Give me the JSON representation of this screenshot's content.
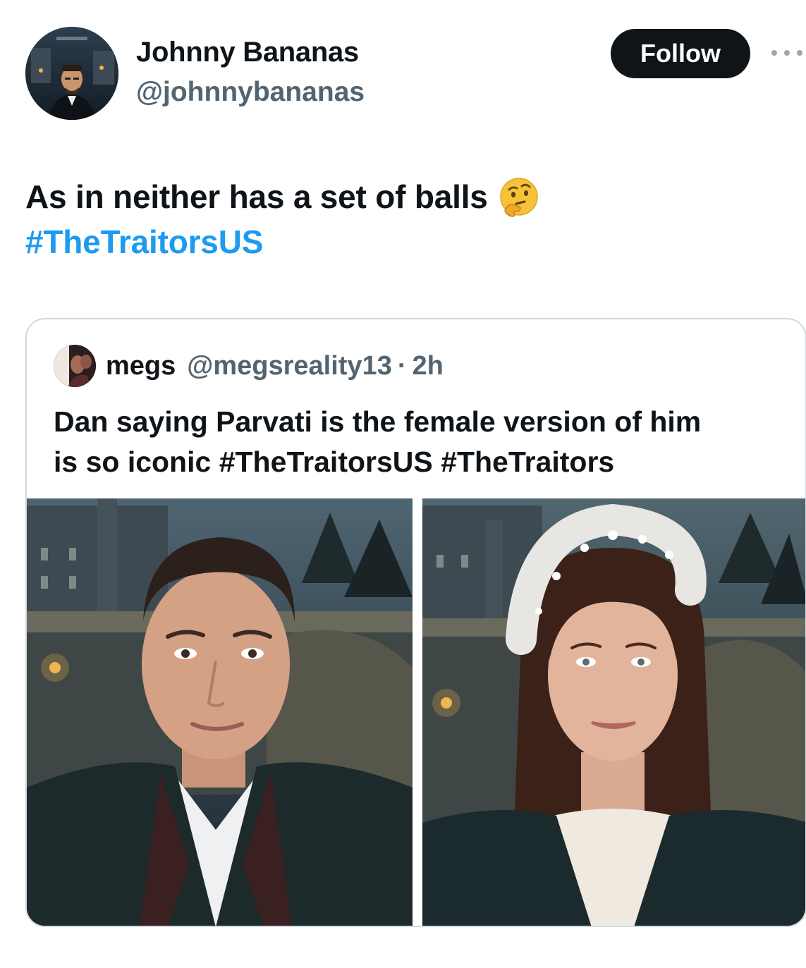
{
  "author": {
    "name": "Johnny Bananas",
    "handle": "@johnnybananas",
    "avatar_icon": "profile-photo"
  },
  "actions": {
    "follow_label": "Follow",
    "more_icon": "ellipsis-icon"
  },
  "tweet": {
    "text": "As in neither has a set of balls",
    "emoji": "thinking-face",
    "hashtag": "#TheTraitorsUS"
  },
  "quote": {
    "name": "megs",
    "handle": "@megsreality13",
    "separator": "·",
    "time": "2h",
    "line1": "Dan saying Parvati is the female version of him",
    "line2_text": "is so iconic ",
    "line2_hashtag1": "#TheTraitorsUS",
    "line2_hashtag2": "#TheTraitors",
    "media": [
      {
        "name": "media-photo-man"
      },
      {
        "name": "media-photo-woman"
      }
    ]
  },
  "colors": {
    "link": "#1d9bf0",
    "text": "#0f1419",
    "secondary": "#536471",
    "border": "#cfd9de",
    "button": "#0f1419"
  }
}
